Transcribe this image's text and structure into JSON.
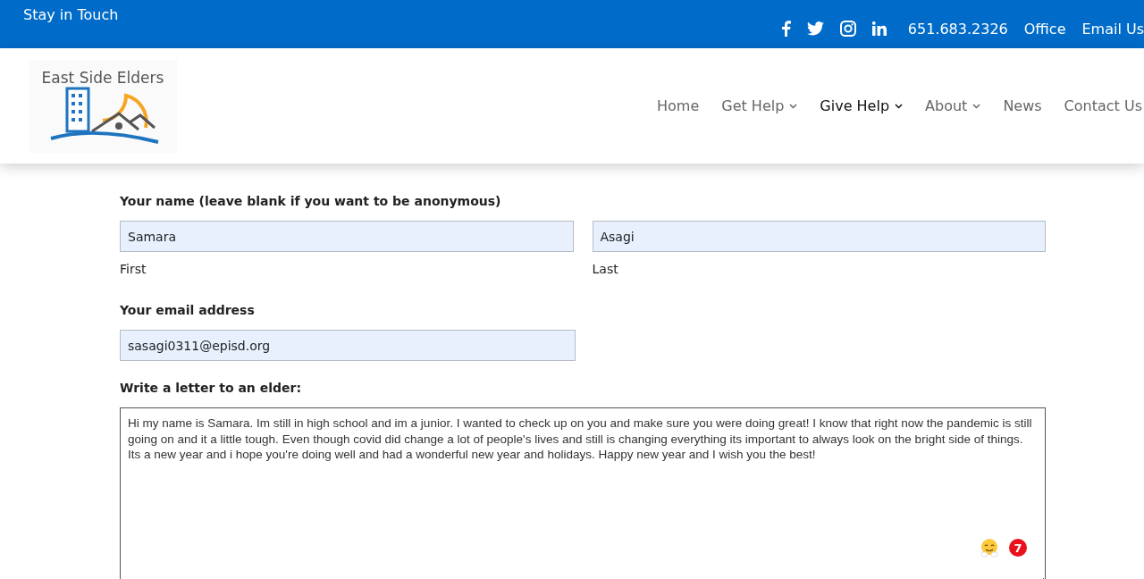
{
  "top_bar": {
    "tagline": "Stay in Touch",
    "phone": "651.683.2326",
    "links": [
      "Office",
      "Email Us"
    ]
  },
  "header": {
    "logo_text": "East Side Elders",
    "nav": [
      {
        "label": "Home",
        "dropdown": false,
        "selected": false
      },
      {
        "label": "Get Help",
        "dropdown": true,
        "selected": false
      },
      {
        "label": "Give Help",
        "dropdown": true,
        "selected": true
      },
      {
        "label": "About",
        "dropdown": true,
        "selected": false
      },
      {
        "label": "News",
        "dropdown": false,
        "selected": false
      },
      {
        "label": "Contact Us",
        "dropdown": false,
        "selected": false
      }
    ]
  },
  "form": {
    "name_label": "Your name (leave blank if you want to be anonymous)",
    "first": {
      "value": "Samara",
      "sublabel": "First"
    },
    "last": {
      "value": "Asagi",
      "sublabel": "Last"
    },
    "email_label": "Your email address",
    "email": "sasagi0311@episd.org",
    "letter_label": "Write a letter to an elder:",
    "letter": "Hi my name is Samara. Im still in high school and im a junior. I wanted to check up on you and make sure you were doing great! I know that right now the pandemic is still going on and it a little tough. Even though covid did change a lot of people's lives and still is changing everything its important to always look on the bright side of things. Its a new year and i hope you're doing well and had a wonderful new year and holidays. Happy new year and I wish you the best!",
    "badge_count": "7"
  }
}
